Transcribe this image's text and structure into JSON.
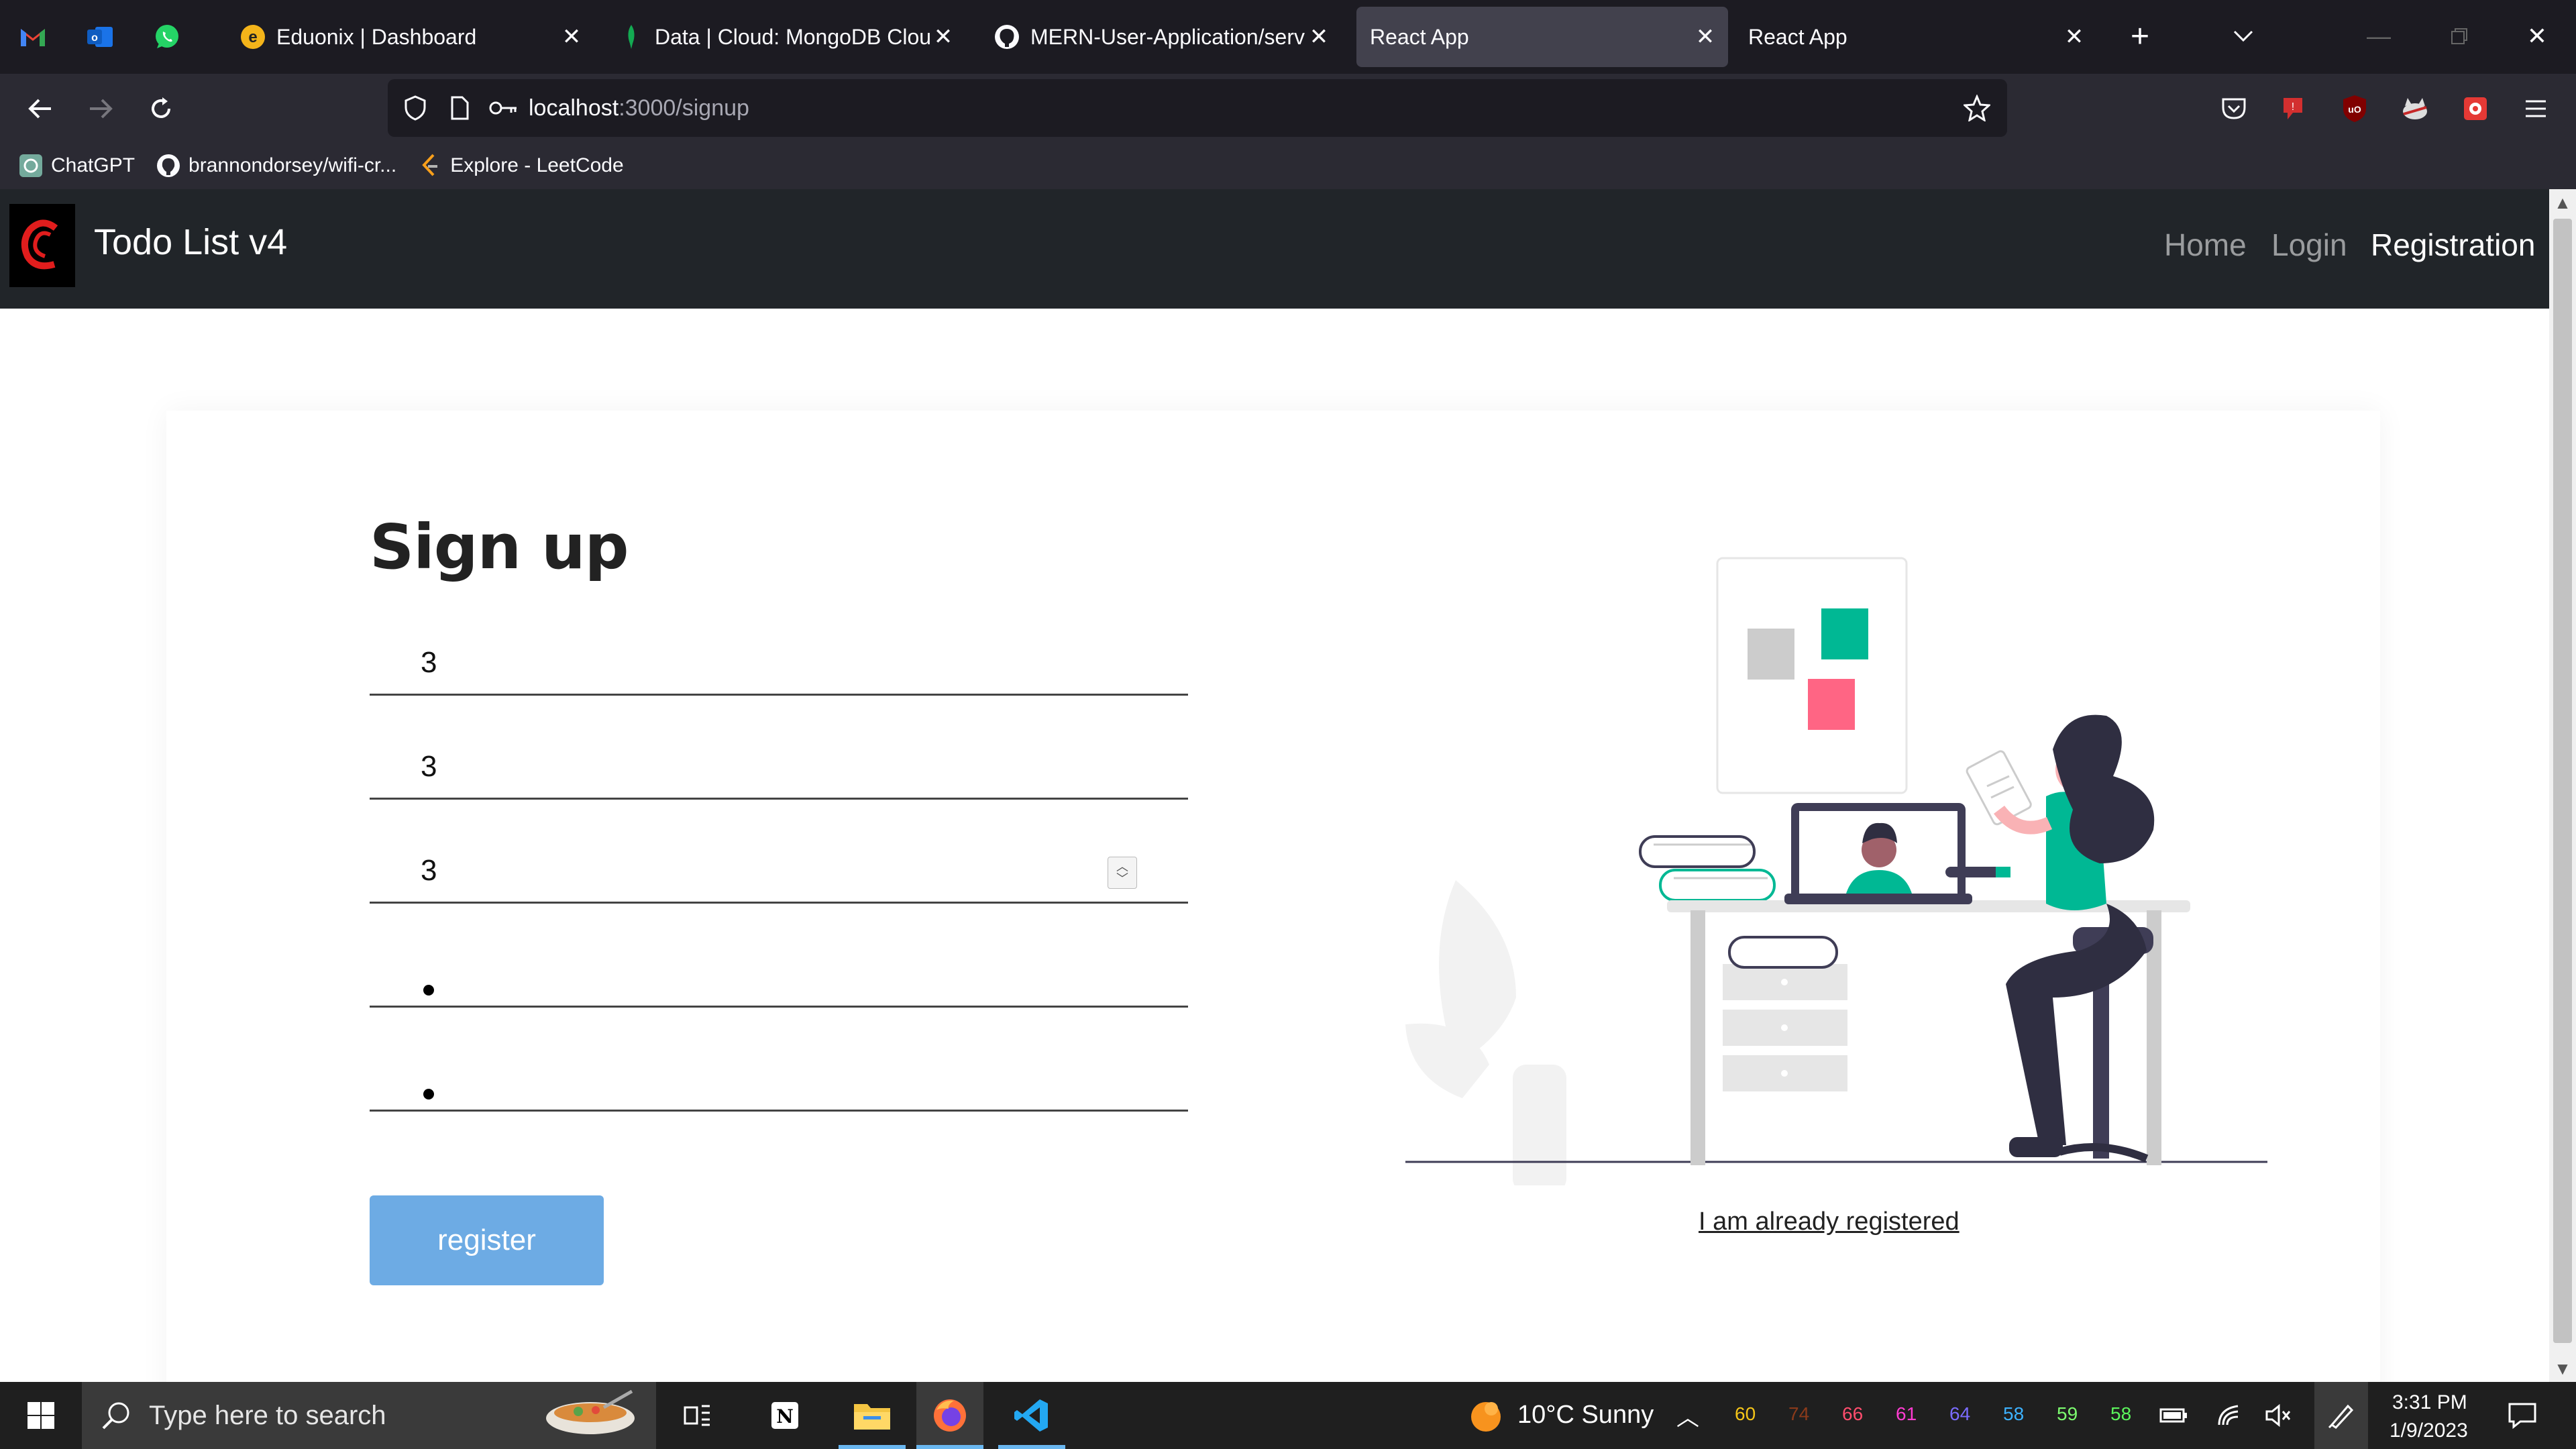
{
  "browser": {
    "tabs": [
      {
        "label": "Eduonix | Dashboard",
        "icon": "eduonix-icon"
      },
      {
        "label": "Data | Cloud: MongoDB Cloud",
        "icon": "mongodb-leaf-icon"
      },
      {
        "label": "MERN-User-Application/server",
        "icon": "github-icon"
      },
      {
        "label": "React App",
        "icon": "none"
      },
      {
        "label": "React App",
        "icon": "none"
      }
    ],
    "url_host": "localhost",
    "url_path": ":3000/signup",
    "bookmarks": [
      {
        "label": "ChatGPT",
        "icon": "chatgpt-icon"
      },
      {
        "label": "brannondorsey/wifi-cr...",
        "icon": "github-icon"
      },
      {
        "label": "Explore - LeetCode",
        "icon": "leetcode-icon"
      }
    ]
  },
  "app": {
    "brand": "Todo List v4",
    "nav": {
      "home": "Home",
      "login": "Login",
      "registration": "Registration"
    },
    "signup": {
      "title": "Sign up",
      "fields": {
        "name": "3",
        "email": "3",
        "phone": "3",
        "password": "•",
        "confirm": "•"
      },
      "register_label": "register",
      "already_label": "I am already registered"
    }
  },
  "taskbar": {
    "search_placeholder": "Type here to search",
    "weather": "10°C  Sunny",
    "perf": [
      {
        "value": "60",
        "color": "#f5c518"
      },
      {
        "value": "74",
        "color": "#8b3a1a"
      },
      {
        "value": "66",
        "color": "#ff4d6d"
      },
      {
        "value": "61",
        "color": "#ff3cd1"
      },
      {
        "value": "64",
        "color": "#7a6cff"
      },
      {
        "value": "58",
        "color": "#3db2ff"
      },
      {
        "value": "59",
        "color": "#7cfc6f"
      },
      {
        "value": "58",
        "color": "#5cf55c"
      }
    ],
    "time": "3:31 PM",
    "date": "1/9/2023"
  },
  "colors": {
    "accent_teal": "#00b894",
    "accent_pink": "#ff6584",
    "register_blue": "#6dabe4"
  }
}
